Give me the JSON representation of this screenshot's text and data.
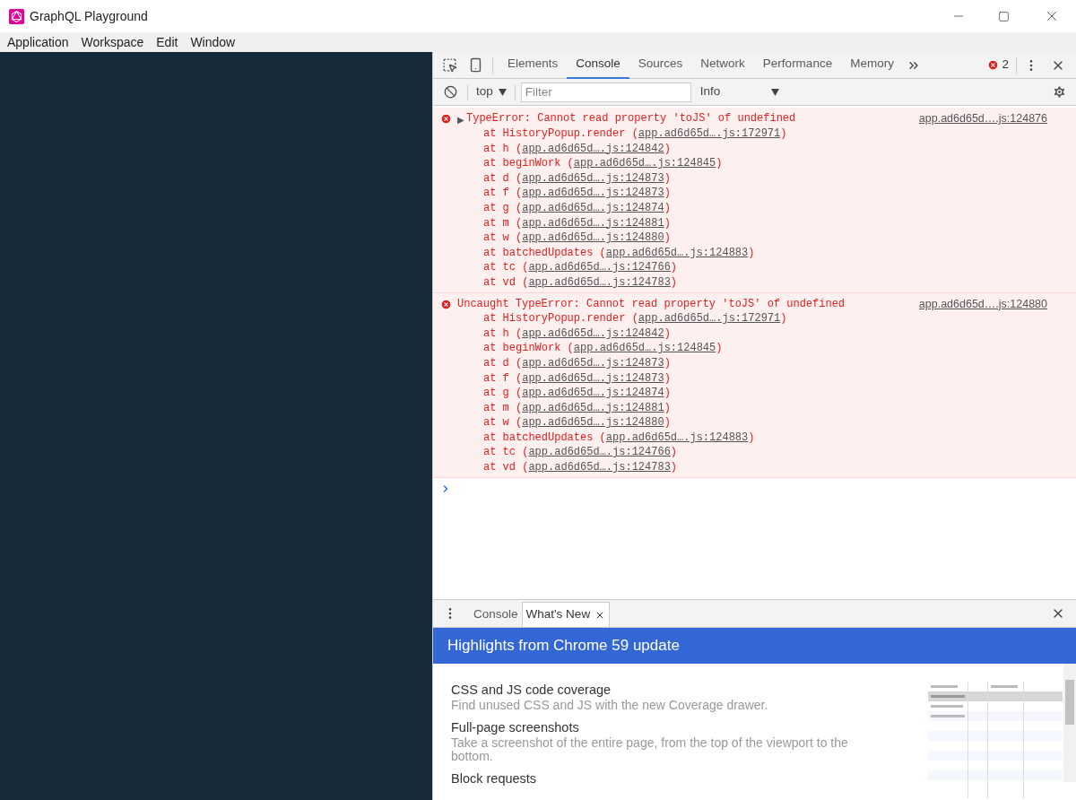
{
  "window": {
    "title": "GraphQL Playground"
  },
  "menu": [
    "Application",
    "Workspace",
    "Edit",
    "Window"
  ],
  "devtools": {
    "tabs": [
      {
        "label": "Elements",
        "selected": false
      },
      {
        "label": "Console",
        "selected": true
      },
      {
        "label": "Sources",
        "selected": false
      },
      {
        "label": "Network",
        "selected": false
      },
      {
        "label": "Performance",
        "selected": false
      },
      {
        "label": "Memory",
        "selected": false
      }
    ],
    "error_count": "2",
    "context": "top",
    "filter": {
      "placeholder": "Filter"
    },
    "level": "Info",
    "messages": [
      {
        "kind": "error",
        "expander": "▶",
        "text": "TypeError: Cannot read property 'toJS' of undefined",
        "source": "app.ad6d65d….js:124876",
        "frames": [
          {
            "fn": "at HistoryPopup.render (",
            "link": "app.ad6d65d….js:172971",
            "close": ")"
          },
          {
            "fn": "at h (",
            "link": "app.ad6d65d….js:124842",
            "close": ")"
          },
          {
            "fn": "at beginWork (",
            "link": "app.ad6d65d….js:124845",
            "close": ")"
          },
          {
            "fn": "at d (",
            "link": "app.ad6d65d….js:124873",
            "close": ")"
          },
          {
            "fn": "at f (",
            "link": "app.ad6d65d….js:124873",
            "close": ")"
          },
          {
            "fn": "at g (",
            "link": "app.ad6d65d….js:124874",
            "close": ")"
          },
          {
            "fn": "at m (",
            "link": "app.ad6d65d….js:124881",
            "close": ")"
          },
          {
            "fn": "at w (",
            "link": "app.ad6d65d….js:124880",
            "close": ")"
          },
          {
            "fn": "at batchedUpdates (",
            "link": "app.ad6d65d….js:124883",
            "close": ")"
          },
          {
            "fn": "at tc (",
            "link": "app.ad6d65d….js:124766",
            "close": ")"
          },
          {
            "fn": "at vd (",
            "link": "app.ad6d65d….js:124783",
            "close": ")"
          }
        ]
      },
      {
        "kind": "error",
        "text": "Uncaught TypeError: Cannot read property 'toJS' of undefined",
        "source": "app.ad6d65d….js:124880",
        "frames": [
          {
            "fn": "at HistoryPopup.render (",
            "link": "app.ad6d65d….js:172971",
            "close": ")"
          },
          {
            "fn": "at h (",
            "link": "app.ad6d65d….js:124842",
            "close": ")"
          },
          {
            "fn": "at beginWork (",
            "link": "app.ad6d65d….js:124845",
            "close": ")"
          },
          {
            "fn": "at d (",
            "link": "app.ad6d65d….js:124873",
            "close": ")"
          },
          {
            "fn": "at f (",
            "link": "app.ad6d65d….js:124873",
            "close": ")"
          },
          {
            "fn": "at g (",
            "link": "app.ad6d65d….js:124874",
            "close": ")"
          },
          {
            "fn": "at m (",
            "link": "app.ad6d65d….js:124881",
            "close": ")"
          },
          {
            "fn": "at w (",
            "link": "app.ad6d65d….js:124880",
            "close": ")"
          },
          {
            "fn": "at batchedUpdates (",
            "link": "app.ad6d65d….js:124883",
            "close": ")"
          },
          {
            "fn": "at tc (",
            "link": "app.ad6d65d….js:124766",
            "close": ")"
          },
          {
            "fn": "at vd (",
            "link": "app.ad6d65d….js:124783",
            "close": ")"
          }
        ]
      }
    ],
    "drawer": {
      "tabs": [
        {
          "label": "Console",
          "selected": false,
          "closable": false
        },
        {
          "label": "What's New",
          "selected": true,
          "closable": true
        }
      ],
      "banner": "Highlights from Chrome 59 update",
      "features": [
        {
          "title": "CSS and JS code coverage",
          "description": "Find unused CSS and JS with the new Coverage drawer."
        },
        {
          "title": "Full-page screenshots",
          "description": "Take a screenshot of the entire page, from the top of the viewport to the bottom."
        },
        {
          "title": "Block requests"
        }
      ]
    }
  }
}
